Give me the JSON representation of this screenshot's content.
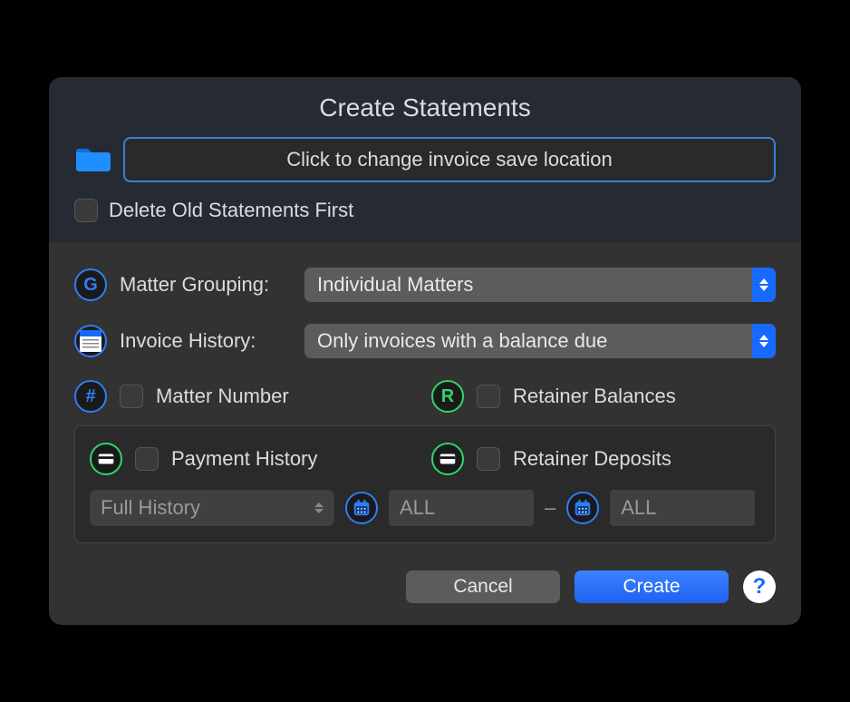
{
  "title": "Create Statements",
  "location_button": "Click to change invoice save location",
  "delete_old_label": "Delete Old Statements First",
  "delete_old_checked": false,
  "matter_grouping": {
    "label": "Matter Grouping:",
    "value": "Individual Matters",
    "badge": "G"
  },
  "invoice_history": {
    "label": "Invoice History:",
    "value": "Only invoices with a balance due"
  },
  "matter_number": {
    "label": "Matter Number",
    "badge": "#",
    "checked": false
  },
  "retainer_balances": {
    "label": "Retainer Balances",
    "badge": "R",
    "checked": false
  },
  "payment_history": {
    "label": "Payment History",
    "checked": false
  },
  "retainer_deposits": {
    "label": "Retainer Deposits",
    "checked": false
  },
  "history_range_select": "Full History",
  "date_from": "ALL",
  "date_to": "ALL",
  "date_separator": "–",
  "buttons": {
    "cancel": "Cancel",
    "create": "Create"
  },
  "help_glyph": "?"
}
